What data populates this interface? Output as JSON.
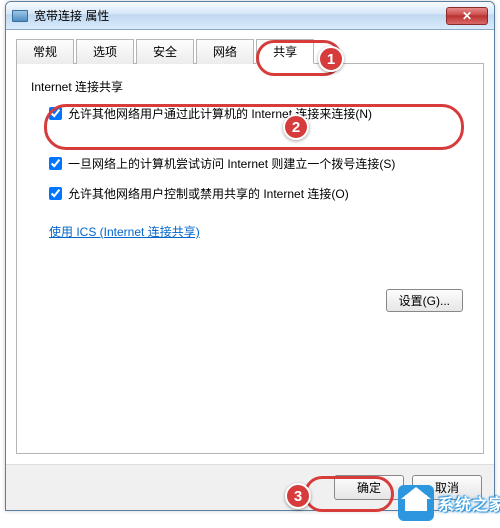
{
  "window": {
    "title": "宽带连接 属性"
  },
  "close_glyph": "✕",
  "tabs": {
    "general": "常规",
    "options": "选项",
    "security": "安全",
    "network": "网络",
    "sharing": "共享"
  },
  "panel": {
    "group_title": "Internet 连接共享",
    "check1": "允许其他网络用户通过此计算机的 Internet 连接来连接(N)",
    "check2": "一旦网络上的计算机尝试访问 Internet 则建立一个拨号连接(S)",
    "check3": "允许其他网络用户控制或禁用共享的 Internet 连接(O)",
    "link": "使用 ICS (Internet 连接共享)",
    "settings": "设置(G)..."
  },
  "footer": {
    "ok": "确定",
    "cancel": "取消"
  },
  "callouts": {
    "c1": "1",
    "c2": "2",
    "c3": "3"
  },
  "watermark": "系统之家"
}
